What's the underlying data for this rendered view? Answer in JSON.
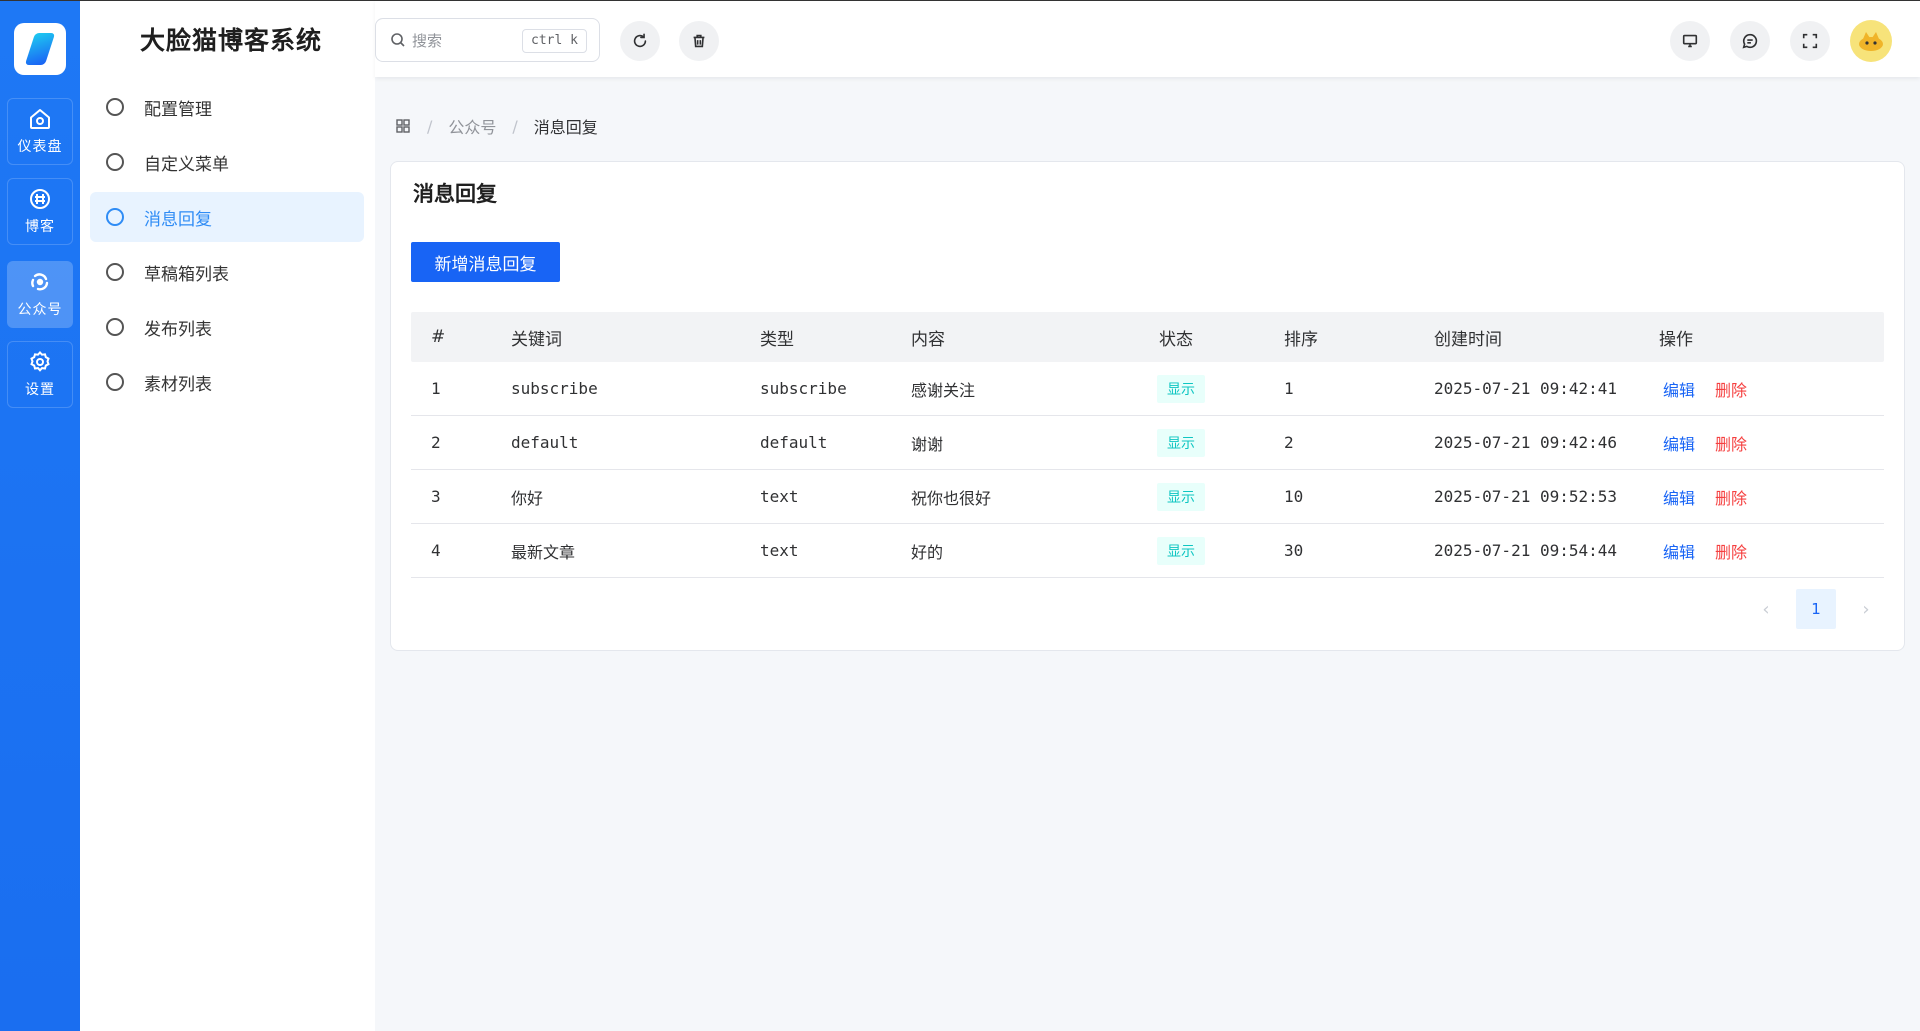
{
  "app": {
    "brand": "大脸猫博客系统"
  },
  "rail": {
    "items": [
      {
        "label": "仪表盘",
        "icon": "dashboard-icon"
      },
      {
        "label": "博客",
        "icon": "blog-icon"
      },
      {
        "label": "公众号",
        "icon": "wechat-icon",
        "active": true
      },
      {
        "label": "设置",
        "icon": "settings-icon"
      }
    ]
  },
  "menu": {
    "items": [
      {
        "label": "配置管理"
      },
      {
        "label": "自定义菜单"
      },
      {
        "label": "消息回复",
        "active": true
      },
      {
        "label": "草稿箱列表"
      },
      {
        "label": "发布列表"
      },
      {
        "label": "素材列表"
      }
    ]
  },
  "header": {
    "search_placeholder": "搜索",
    "search_shortcut": "ctrl k",
    "buttons": [
      "refresh-icon",
      "trash-icon",
      "monitor-icon",
      "message-icon",
      "fullscreen-icon"
    ]
  },
  "breadcrumb": {
    "items": [
      "公众号",
      "消息回复"
    ]
  },
  "card": {
    "title": "消息回复",
    "add_button": "新增消息回复"
  },
  "table": {
    "columns": [
      "#",
      "关键词",
      "类型",
      "内容",
      "状态",
      "排序",
      "创建时间",
      "操作"
    ],
    "rows": [
      {
        "index": "1",
        "keyword": "subscribe",
        "type": "subscribe",
        "content": "感谢关注",
        "status": "显示",
        "sort": "1",
        "created": "2025-07-21 09:42:41"
      },
      {
        "index": "2",
        "keyword": "default",
        "type": "default",
        "content": "谢谢",
        "status": "显示",
        "sort": "2",
        "created": "2025-07-21 09:42:46"
      },
      {
        "index": "3",
        "keyword": "你好",
        "type": "text",
        "content": "祝你也很好",
        "status": "显示",
        "sort": "10",
        "created": "2025-07-21 09:52:53"
      },
      {
        "index": "4",
        "keyword": "最新文章",
        "type": "text",
        "content": "好的",
        "status": "显示",
        "sort": "30",
        "created": "2025-07-21 09:54:44"
      }
    ],
    "actions": {
      "edit": "编辑",
      "delete": "删除"
    }
  },
  "pagination": {
    "current": "1",
    "prev": "‹",
    "next": "›"
  },
  "colors": {
    "primary": "#1864f5",
    "rail": "#1e78f5",
    "danger": "#f53f3f",
    "tag_text": "#0fc6c2",
    "tag_bg": "#e8fffb"
  }
}
